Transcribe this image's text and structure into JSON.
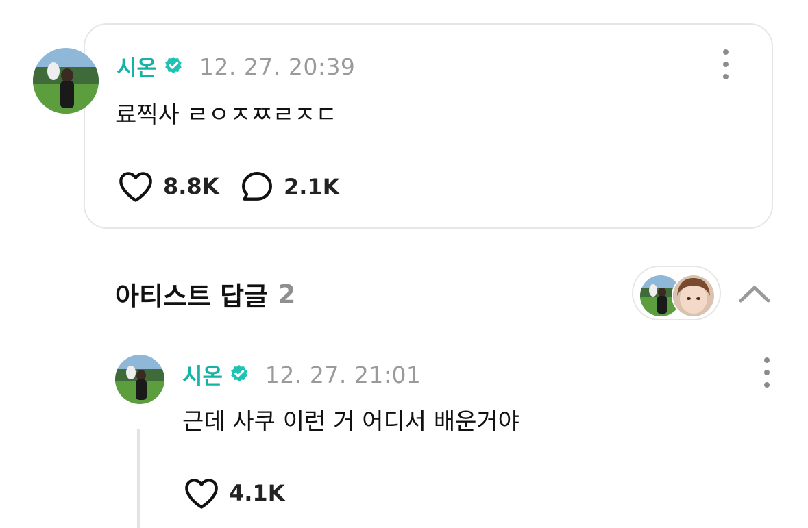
{
  "post": {
    "author": "시온",
    "timestamp": "12. 27. 20:39",
    "text": "료찍사 ㄹㅇㅈㅉㄹㅈㄷ",
    "likes": "8.8K",
    "comments": "2.1K"
  },
  "replies_section": {
    "title": "아티스트 답글",
    "count": "2"
  },
  "reply": {
    "author": "시온",
    "timestamp": "12. 27. 21:01",
    "text": "근데 사쿠 이런 거 어디서 배운거야",
    "likes": "4.1K"
  },
  "colors": {
    "accent": "#15b3a6",
    "verified": "#1ec3b5",
    "muted": "#9a9a9a",
    "border": "#e6e6e6"
  }
}
